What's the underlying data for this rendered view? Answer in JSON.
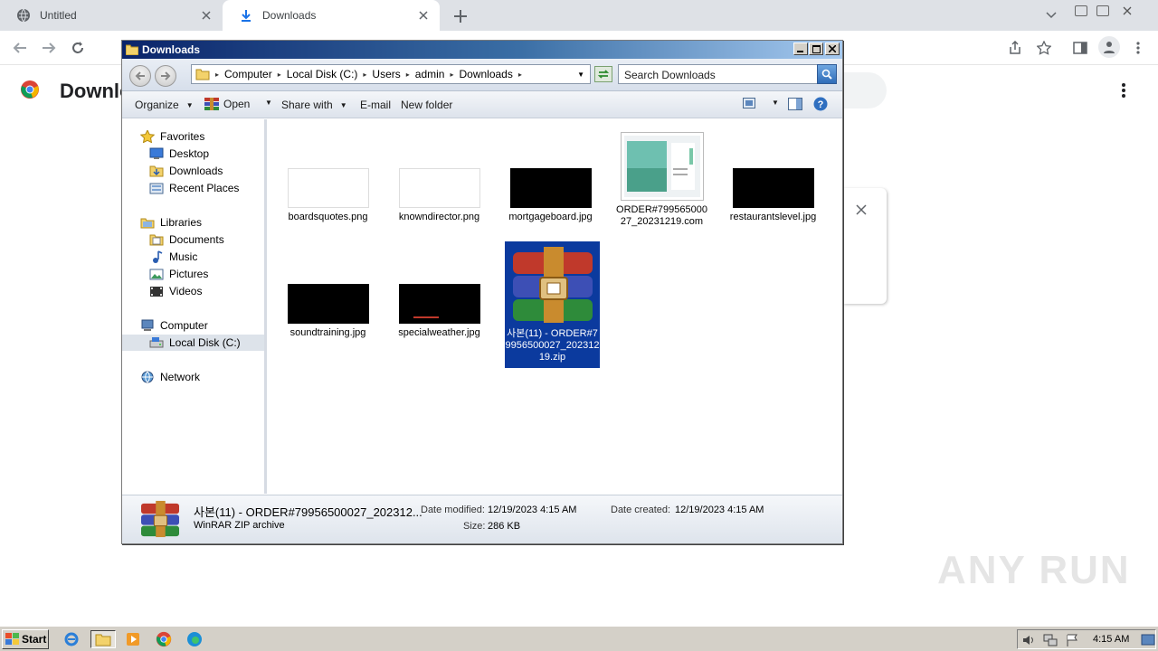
{
  "browser": {
    "tabs": [
      {
        "label": "Untitled",
        "icon": "globe-icon"
      },
      {
        "label": "Downloads",
        "icon": "download-icon"
      }
    ],
    "page_title": "Downlo"
  },
  "explorer": {
    "title": "Downloads",
    "breadcrumbs": [
      "Computer",
      "Local Disk (C:)",
      "Users",
      "admin",
      "Downloads"
    ],
    "search_placeholder": "Search Downloads",
    "commands": {
      "organize": "Organize",
      "open": "Open",
      "share_with": "Share with",
      "email": "E-mail",
      "new_folder": "New folder"
    },
    "nav": {
      "favorites": "Favorites",
      "desktop": "Desktop",
      "downloads": "Downloads",
      "recent_places": "Recent Places",
      "libraries": "Libraries",
      "documents": "Documents",
      "music": "Music",
      "pictures": "Pictures",
      "videos": "Videos",
      "computer": "Computer",
      "local_disk": "Local Disk (C:)",
      "network": "Network"
    },
    "files": [
      {
        "name": "boardsquotes.png"
      },
      {
        "name": "knowndirector.png"
      },
      {
        "name": "mortgageboard.jpg"
      },
      {
        "name": "ORDER#79956500027_20231219.com"
      },
      {
        "name": "restaurantslevel.jpg"
      },
      {
        "name": "soundtraining.jpg"
      },
      {
        "name": "specialweather.jpg"
      },
      {
        "name": "사본(11) - ORDER#79956500027_20231219.zip"
      }
    ],
    "details": {
      "name": "사본(11) - ORDER#79956500027_202312...",
      "type": "WinRAR ZIP archive",
      "date_modified_label": "Date modified:",
      "date_modified": "12/19/2023 4:15 AM",
      "date_created_label": "Date created:",
      "date_created": "12/19/2023 4:15 AM",
      "size_label": "Size:",
      "size": "286 KB"
    }
  },
  "taskbar": {
    "start": "Start",
    "clock": "4:15 AM"
  },
  "watermark": "ANY RUN"
}
